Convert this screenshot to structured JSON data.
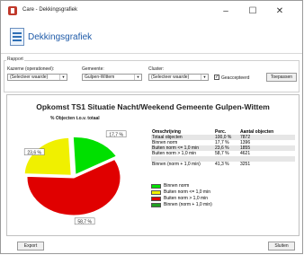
{
  "window": {
    "title": "Care - Dekkingsgrafiek",
    "minimize": "–",
    "maximize": "☐",
    "close": "✕"
  },
  "header": {
    "title": "Dekkingsgrafiek"
  },
  "rapport": {
    "legend": "Rapport",
    "kazerne_label": "Kazerne (operationeel):",
    "kazerne_value": "(Selecteer waarde)",
    "gemeente_label": "Gemeente:",
    "gemeente_value": "Gulpen-Wittem",
    "cluster_label": "Cluster:",
    "cluster_value": "(Selecteer waarde)",
    "geaccepteerd_label": "Geaccepteerd",
    "geaccepteerd_checked": true,
    "toepassen_label": "Toepassen"
  },
  "report": {
    "title": "Opkomst TS1 Situatie Nacht/Weekend Gemeente Gulpen-Wittem",
    "chart_title": "% Objecten t.o.v. totaal",
    "table_headers": [
      "Omschrijving",
      "Perc.",
      "Aantal objecten"
    ],
    "table_rows": [
      [
        "Totaal objecten",
        "100,0 %",
        "7872"
      ],
      [
        "Binnen norm",
        "17,7 %",
        "1396"
      ],
      [
        "Buiten norm <= 1,0 min",
        "23,6 %",
        "1855"
      ],
      [
        "Buiten norm > 1,0 min",
        "58,7 %",
        "4621"
      ],
      [
        "",
        "",
        ""
      ],
      [
        "Binnen (norm + 1,0 min)",
        "41,3 %",
        "3251"
      ]
    ],
    "legend_items": [
      {
        "label": "Binnen norm",
        "color": "#00e000"
      },
      {
        "label": "Buiten norm <= 1,0 min",
        "color": "#f0f000"
      },
      {
        "label": "Buiten norm > 1,0 min",
        "color": "#e00000"
      },
      {
        "label": "Binnen (norm + 1,0 min)",
        "color": "#20a020"
      }
    ]
  },
  "chart_data": {
    "type": "pie",
    "title": "% Objecten t.o.v. totaal",
    "slices": [
      {
        "label": "17,7 %",
        "value": 17.7,
        "color": "#00e000"
      },
      {
        "label": "23,6 %",
        "value": 23.6,
        "color": "#f0f000"
      },
      {
        "label": "58,7 %",
        "value": 58.7,
        "color": "#e00000"
      }
    ]
  },
  "footer": {
    "export_label": "Export",
    "sluiten_label": "Sluiten"
  }
}
